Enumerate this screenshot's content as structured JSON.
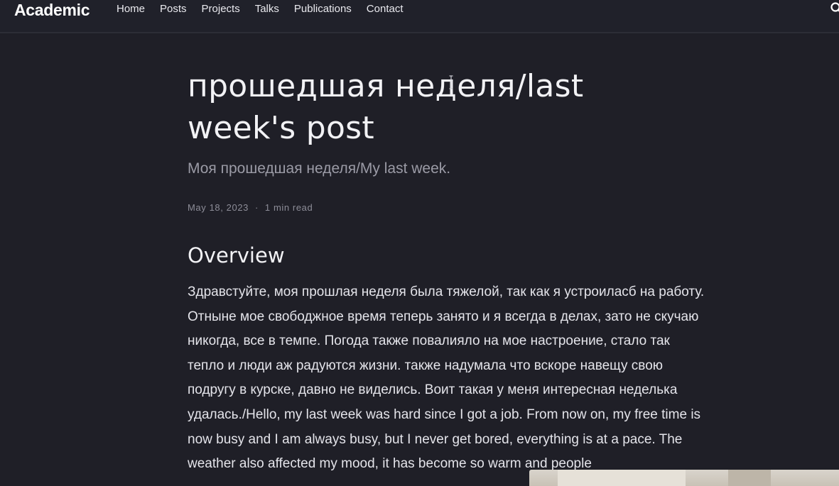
{
  "navbar": {
    "brand": "Academic",
    "links": [
      "Home",
      "Posts",
      "Projects",
      "Talks",
      "Publications",
      "Contact"
    ],
    "search_icon": "search-icon"
  },
  "article": {
    "title": "прошедшая неделя/last week's post",
    "subtitle": "Моя прошедшая неделя/My last week.",
    "date": "May 18, 2023",
    "separator": "·",
    "read_time": "1 min read",
    "section_heading": "Overview",
    "body": "Здравстуйте, моя прошлая неделя была тяжелой, так как я устроиласб на работу. Отныне мое свободжное время теперь занято и я всегда в делах, зато не скучаю никогда, все в темпе. Погода также повалияло на мое настроение, стало так тепло и люди аж радуются жизни. также надумала что вскоре навещу свою подругу в курске, давно не виделись. Воит такая у меня интересная неделька удалась./Hello, my last week was hard since I got a job. From now on, my free time is now busy and I am always busy, but I never get bored, everything is at a pace. The weather also affected my mood, it has become so warm and people"
  },
  "colors": {
    "background": "#1f1f27",
    "navbar": "#20212a",
    "text": "#e4e4ea",
    "muted": "#9b9ba6"
  }
}
